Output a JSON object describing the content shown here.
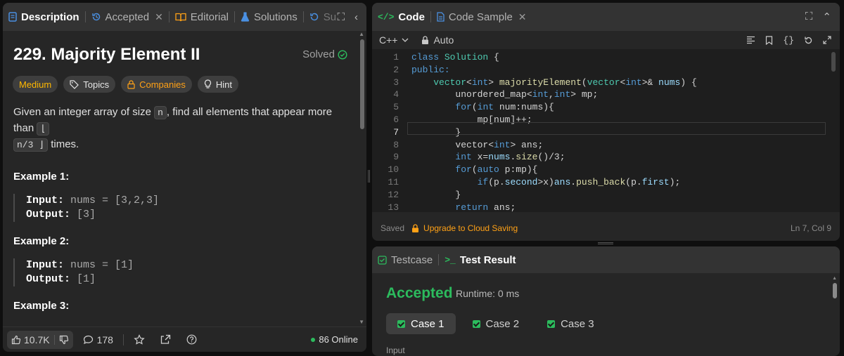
{
  "left_panel": {
    "tabs": [
      {
        "label": "Description",
        "icon": "document-icon"
      },
      {
        "label": "Accepted",
        "icon": "history-icon"
      },
      {
        "label": "Editorial",
        "icon": "book-icon"
      },
      {
        "label": "Solutions",
        "icon": "flask-icon"
      },
      {
        "label": "Su",
        "icon": "history-icon"
      }
    ],
    "problem_title": "229. Majority Element II",
    "solved_label": "Solved",
    "tags": {
      "difficulty": "Medium",
      "topics": "Topics",
      "companies": "Companies",
      "hint": "Hint"
    },
    "description": {
      "pre": "Given an integer array of size",
      "var_n": "n",
      "mid": ", find all elements that appear more than",
      "floor_open": "⌊",
      "floor_expr": "n/3 ⌋",
      "post": "times."
    },
    "examples": [
      {
        "title": "Example 1:",
        "input_label": "Input:",
        "input": "nums = [3,2,3]",
        "output_label": "Output:",
        "output": "[3]"
      },
      {
        "title": "Example 2:",
        "input_label": "Input:",
        "input": "nums = [1]",
        "output_label": "Output:",
        "output": "[1]"
      },
      {
        "title": "Example 3:"
      }
    ],
    "footer": {
      "likes": "10.7K",
      "comments": "178",
      "online": "86 Online"
    }
  },
  "editor": {
    "tabs": [
      {
        "label": "Code",
        "icon": "code-icon"
      },
      {
        "label": "Code Sample",
        "icon": "file-icon"
      }
    ],
    "language": "C++",
    "mode": "Auto",
    "lines": [
      [
        {
          "t": "class ",
          "c": "kw"
        },
        {
          "t": "Solution",
          "c": "ty"
        },
        {
          "t": " {",
          "c": "pl"
        }
      ],
      [
        {
          "t": "public:",
          "c": "kw"
        }
      ],
      [
        {
          "t": "    ",
          "c": "pl"
        },
        {
          "t": "vector",
          "c": "ty"
        },
        {
          "t": "<",
          "c": "pl"
        },
        {
          "t": "int",
          "c": "kw"
        },
        {
          "t": "> ",
          "c": "pl"
        },
        {
          "t": "majorityElement",
          "c": "fn"
        },
        {
          "t": "(",
          "c": "pl"
        },
        {
          "t": "vector",
          "c": "ty"
        },
        {
          "t": "<",
          "c": "pl"
        },
        {
          "t": "int",
          "c": "kw"
        },
        {
          "t": ">& ",
          "c": "pl"
        },
        {
          "t": "nums",
          "c": "id"
        },
        {
          "t": ") {",
          "c": "pl"
        }
      ],
      [
        {
          "t": "        unordered_map",
          "c": "pl"
        },
        {
          "t": "<",
          "c": "pl"
        },
        {
          "t": "int",
          "c": "kw"
        },
        {
          "t": ",",
          "c": "pl"
        },
        {
          "t": "int",
          "c": "kw"
        },
        {
          "t": "> mp;",
          "c": "pl"
        }
      ],
      [
        {
          "t": "        ",
          "c": "pl"
        },
        {
          "t": "for",
          "c": "kw"
        },
        {
          "t": "(",
          "c": "pl"
        },
        {
          "t": "int",
          "c": "kw"
        },
        {
          "t": " num:nums){",
          "c": "pl"
        }
      ],
      [
        {
          "t": "            mp[num]++;",
          "c": "pl"
        }
      ],
      [
        {
          "t": "        }",
          "c": "pl"
        }
      ],
      [
        {
          "t": "        vector",
          "c": "pl"
        },
        {
          "t": "<",
          "c": "pl"
        },
        {
          "t": "int",
          "c": "kw"
        },
        {
          "t": "> ans;",
          "c": "pl"
        }
      ],
      [
        {
          "t": "        ",
          "c": "pl"
        },
        {
          "t": "int",
          "c": "kw"
        },
        {
          "t": " x=",
          "c": "pl"
        },
        {
          "t": "nums",
          "c": "id"
        },
        {
          "t": ".",
          "c": "pl"
        },
        {
          "t": "size",
          "c": "fn"
        },
        {
          "t": "()/3;",
          "c": "pl"
        }
      ],
      [
        {
          "t": "        ",
          "c": "pl"
        },
        {
          "t": "for",
          "c": "kw"
        },
        {
          "t": "(",
          "c": "pl"
        },
        {
          "t": "auto",
          "c": "kw"
        },
        {
          "t": " p:mp){",
          "c": "pl"
        }
      ],
      [
        {
          "t": "            ",
          "c": "pl"
        },
        {
          "t": "if",
          "c": "kw"
        },
        {
          "t": "(p.",
          "c": "pl"
        },
        {
          "t": "second",
          "c": "id"
        },
        {
          "t": ">x)",
          "c": "pl"
        },
        {
          "t": "ans",
          "c": "id"
        },
        {
          "t": ".",
          "c": "pl"
        },
        {
          "t": "push_back",
          "c": "fn"
        },
        {
          "t": "(p.",
          "c": "pl"
        },
        {
          "t": "first",
          "c": "id"
        },
        {
          "t": ");",
          "c": "pl"
        }
      ],
      [
        {
          "t": "        }",
          "c": "pl"
        }
      ],
      [
        {
          "t": "        ",
          "c": "pl"
        },
        {
          "t": "return",
          "c": "kw"
        },
        {
          "t": " ans;",
          "c": "pl"
        }
      ]
    ],
    "status_saved": "Saved",
    "status_upgrade": "Upgrade to Cloud Saving",
    "cursor_pos": "Ln 7, Col 9"
  },
  "result": {
    "tabs": [
      {
        "label": "Testcase",
        "icon": "checkbox-icon"
      },
      {
        "label": "Test Result",
        "icon": "terminal-icon"
      }
    ],
    "status": "Accepted",
    "runtime": "Runtime: 0 ms",
    "cases": [
      "Case 1",
      "Case 2",
      "Case 3"
    ],
    "input_label": "Input"
  },
  "colors": {
    "accent_green": "#2cbb5d",
    "medium": "#ffb800",
    "companies": "#ffa116"
  }
}
